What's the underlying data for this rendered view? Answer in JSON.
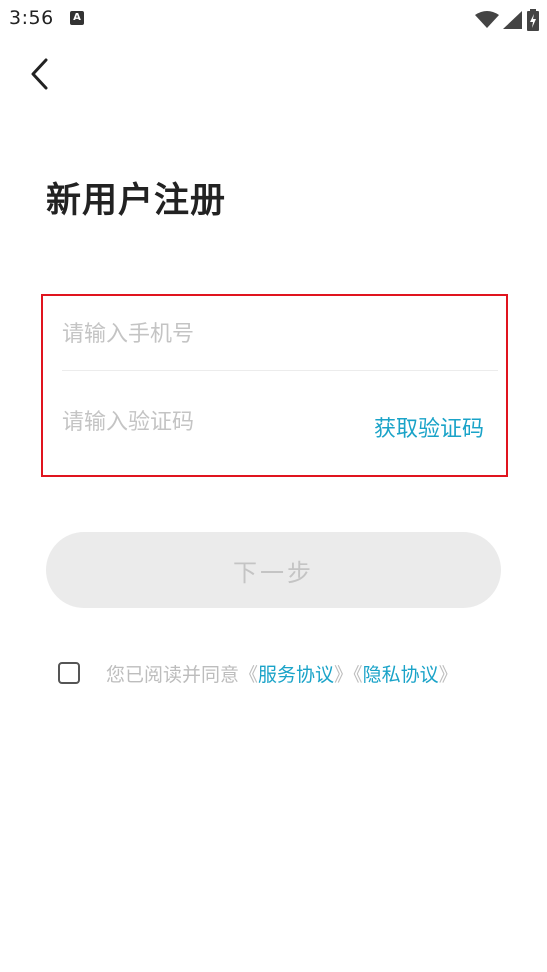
{
  "status_bar": {
    "time": "3:56",
    "notification_letter": "A",
    "icons": [
      "wifi-icon",
      "signal-icon",
      "battery-charging-icon"
    ]
  },
  "header": {
    "back_icon": "chevron-left-icon",
    "title": "新用户注册"
  },
  "form": {
    "phone_placeholder": "请输入手机号",
    "phone_value": "",
    "code_placeholder": "请输入验证码",
    "code_value": "",
    "get_code_label": "获取验证码"
  },
  "next_button": {
    "label": "下一步"
  },
  "agreement": {
    "checked": false,
    "prefix": "您已阅读并同意",
    "open_bracket": "《",
    "close_bracket": "》",
    "service_link": "服务协议",
    "privacy_link": "隐私协议"
  },
  "colors": {
    "accent": "#1aa3c8",
    "highlight_border": "#e0141e",
    "disabled_button_bg": "#ebebeb",
    "placeholder": "#c4c4c4"
  }
}
